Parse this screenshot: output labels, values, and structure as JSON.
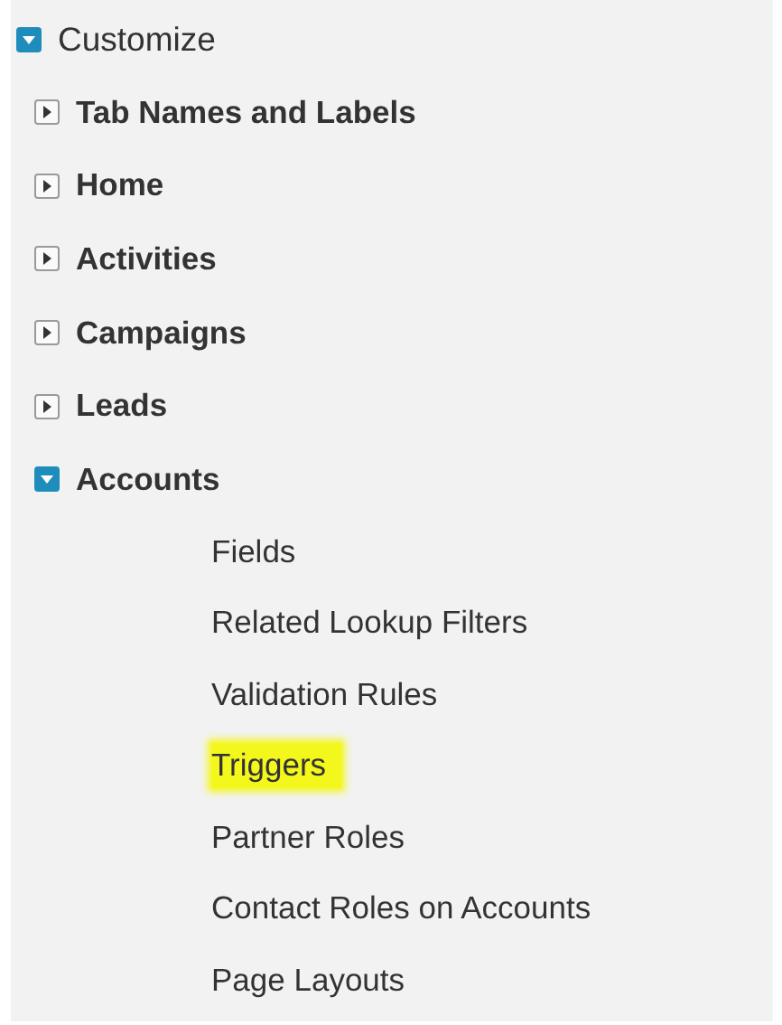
{
  "tree": [
    {
      "label": "Customize",
      "expanded": true,
      "children": [
        {
          "label": "Tab Names and Labels",
          "expanded": false
        },
        {
          "label": "Home",
          "expanded": false
        },
        {
          "label": "Activities",
          "expanded": false
        },
        {
          "label": "Campaigns",
          "expanded": false
        },
        {
          "label": "Leads",
          "expanded": false
        },
        {
          "label": "Accounts",
          "expanded": true,
          "children": [
            {
              "label": "Fields",
              "highlighted": false
            },
            {
              "label": "Related Lookup Filters",
              "highlighted": false
            },
            {
              "label": "Validation Rules",
              "highlighted": false
            },
            {
              "label": "Triggers",
              "highlighted": true
            },
            {
              "label": "Partner Roles",
              "highlighted": false
            },
            {
              "label": "Contact Roles on Accounts",
              "highlighted": false
            },
            {
              "label": "Page Layouts",
              "highlighted": false
            }
          ]
        }
      ]
    }
  ]
}
